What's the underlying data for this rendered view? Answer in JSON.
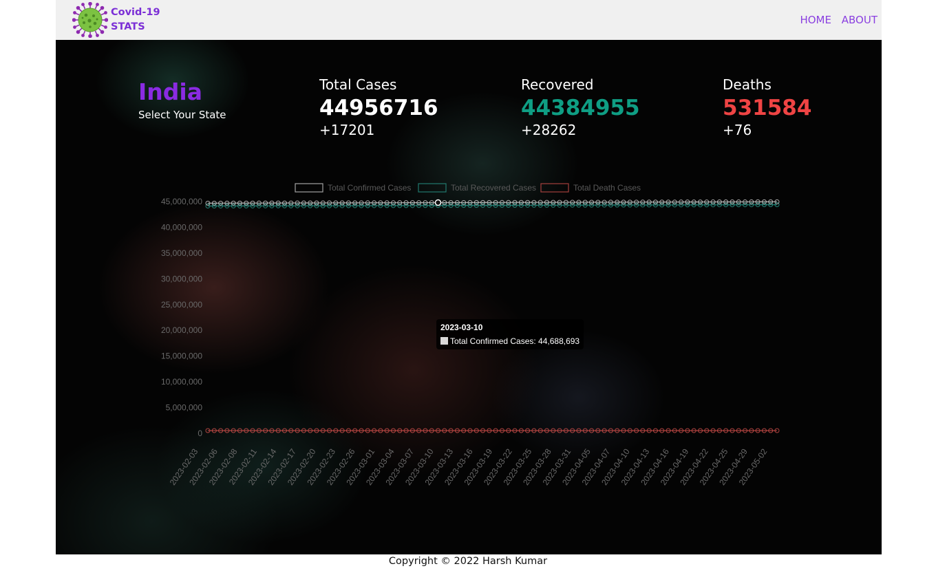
{
  "navbar": {
    "brand_line1": "Covid-19",
    "brand_line2": "STATS",
    "logo_icon": "virus-icon",
    "links": [
      "HOME",
      "ABOUT"
    ]
  },
  "region": {
    "country": "India",
    "select_label": "Select Your State"
  },
  "stats": {
    "total": {
      "label": "Total Cases",
      "value": "44956716",
      "delta": "+17201"
    },
    "recovered": {
      "label": "Recovered",
      "value": "44384955",
      "delta": "+28262"
    },
    "deaths": {
      "label": "Deaths",
      "value": "531584",
      "delta": "+76"
    }
  },
  "colors": {
    "brand": "#7b2fd6",
    "country": "#8a2be2",
    "recovered": "#0f9e84",
    "deaths": "#ef4444",
    "confirmed_series": "#d8d8d8",
    "recovered_series": "#2a9d8f",
    "deaths_series": "#d9534f"
  },
  "chart_data": {
    "type": "line",
    "x_tick_labels": [
      "2023-02-03",
      "2023-02-06",
      "2023-02-08",
      "2023-02-11",
      "2023-02-14",
      "2023-02-17",
      "2023-02-20",
      "2023-02-23",
      "2023-02-26",
      "2023-03-01",
      "2023-03-04",
      "2023-03-07",
      "2023-03-10",
      "2023-03-13",
      "2023-03-16",
      "2023-03-19",
      "2023-03-22",
      "2023-03-25",
      "2023-03-28",
      "2023-03-31",
      "2023-04-05",
      "2023-04-07",
      "2023-04-10",
      "2023-04-13",
      "2023-04-16",
      "2023-04-19",
      "2023-04-22",
      "2023-04-25",
      "2023-04-29",
      "2023-05-02"
    ],
    "point_count": 90,
    "y_ticks": [
      "0",
      "5,000,000",
      "10,000,000",
      "15,000,000",
      "20,000,000",
      "25,000,000",
      "30,000,000",
      "35,000,000",
      "40,000,000",
      "45,000,000"
    ],
    "ylim": [
      0,
      45000000
    ],
    "legend_position": "top-center",
    "series": [
      {
        "name": "Total Confirmed Cases",
        "start": 44684000,
        "end": 44956716,
        "color": "#d8d8d8"
      },
      {
        "name": "Total Recovered Cases",
        "start": 44132000,
        "end": 44384955,
        "color": "#2a9d8f"
      },
      {
        "name": "Total Death Cases",
        "start": 530750,
        "end": 531584,
        "color": "#d9534f"
      }
    ],
    "tooltip": {
      "date": "2023-03-10",
      "label": "Total Confirmed Cases: 44,688,693",
      "index": 36
    }
  },
  "footer": {
    "copyright": "Copyright © 2022 Harsh Kumar"
  }
}
